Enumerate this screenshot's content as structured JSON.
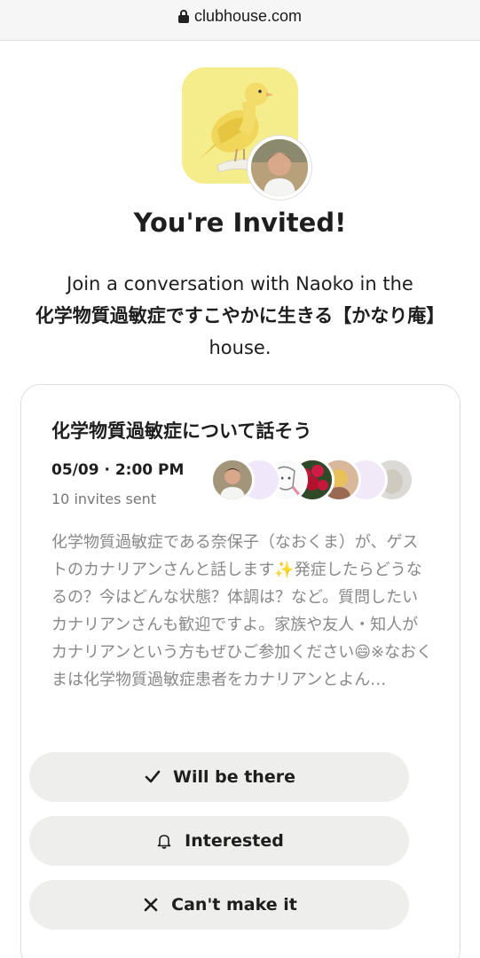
{
  "browser": {
    "url": "clubhouse.com"
  },
  "invite": {
    "title": "You're Invited!",
    "line1": "Join a conversation with Naoko in the",
    "house_name": "化学物質過敏症ですこやかに生きる【かなり庵】",
    "house_suffix": " house."
  },
  "event": {
    "title": "化学物質過敏症について話そう",
    "date": "05/09 · 2:00 PM",
    "invites_sent": "10 invites sent",
    "description": "化学物質過敏症である奈保子（なおくま）が、ゲストのカナリアンさんと話します✨発症したらどうなるの？今はどんな状態？体調は？など。質問したいカナリアンさんも歓迎ですよ。家族や友人・知人がカナリアンという方もぜひご参加ください😄※なおくまは化学物質過敏症患者をカナリアンとよん…"
  },
  "actions": {
    "will_be_there": "Will be there",
    "interested": "Interested",
    "cant_make_it": "Can't make it"
  },
  "colors": {
    "house_bg": "#f5ec8c",
    "button_bg": "#eeeeec",
    "muted_text": "#888888"
  },
  "icons": [
    "lock-icon",
    "check-icon",
    "bell-icon",
    "x-icon"
  ]
}
